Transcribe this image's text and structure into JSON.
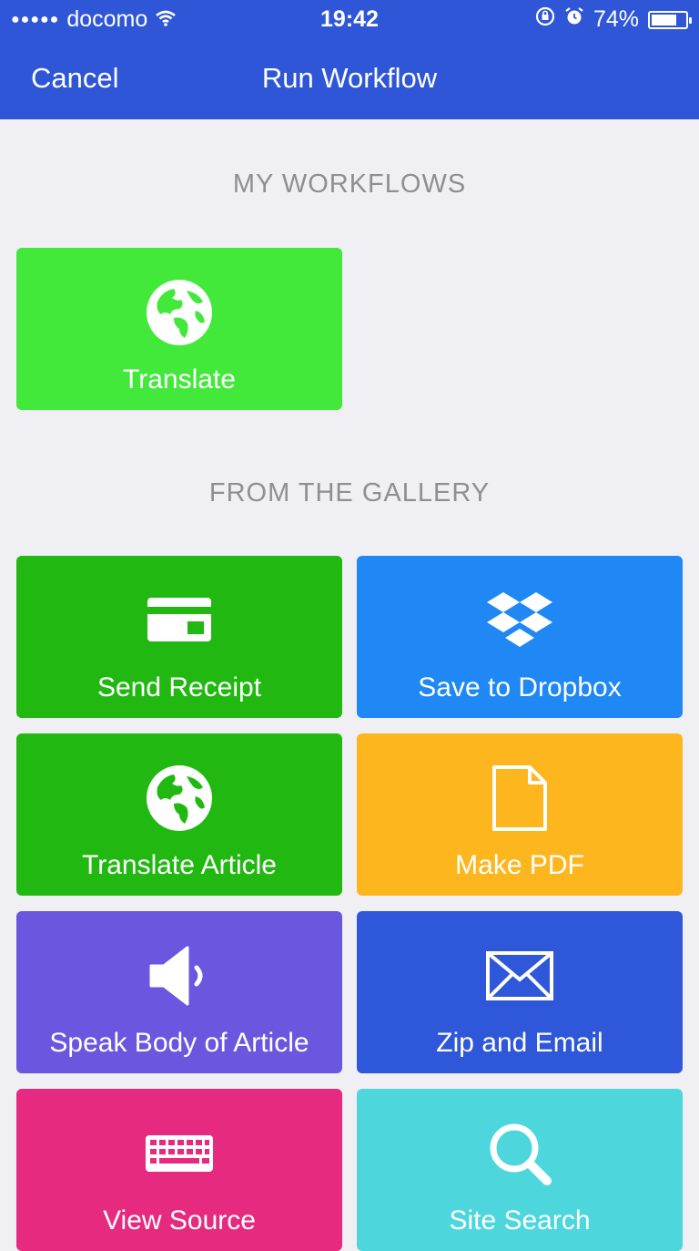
{
  "status_bar": {
    "carrier": "docomo",
    "time": "19:42",
    "battery": "74%",
    "battery_level": 0.74
  },
  "nav": {
    "cancel_label": "Cancel",
    "title": "Run Workflow"
  },
  "my_workflows": {
    "header": "MY WORKFLOWS",
    "items": [
      {
        "label": "Translate",
        "icon": "globe-icon",
        "color": "#42e83a"
      }
    ]
  },
  "gallery": {
    "header": "FROM THE GALLERY",
    "items": [
      {
        "label": "Send Receipt",
        "icon": "credit-card-icon",
        "color": "#22b812"
      },
      {
        "label": "Save to Dropbox",
        "icon": "dropbox-icon",
        "color": "#1f88f4"
      },
      {
        "label": "Translate Article",
        "icon": "globe-icon",
        "color": "#22b812"
      },
      {
        "label": "Make PDF",
        "icon": "document-icon",
        "color": "#fdb61d"
      },
      {
        "label": "Speak Body of Article",
        "icon": "speaker-icon",
        "color": "#6b56e0"
      },
      {
        "label": "Zip and Email",
        "icon": "envelope-icon",
        "color": "#2e57d9"
      },
      {
        "label": "View Source",
        "icon": "keyboard-icon",
        "color": "#e52a80"
      },
      {
        "label": "Site Search",
        "icon": "search-icon",
        "color": "#4dd6dc"
      }
    ]
  }
}
